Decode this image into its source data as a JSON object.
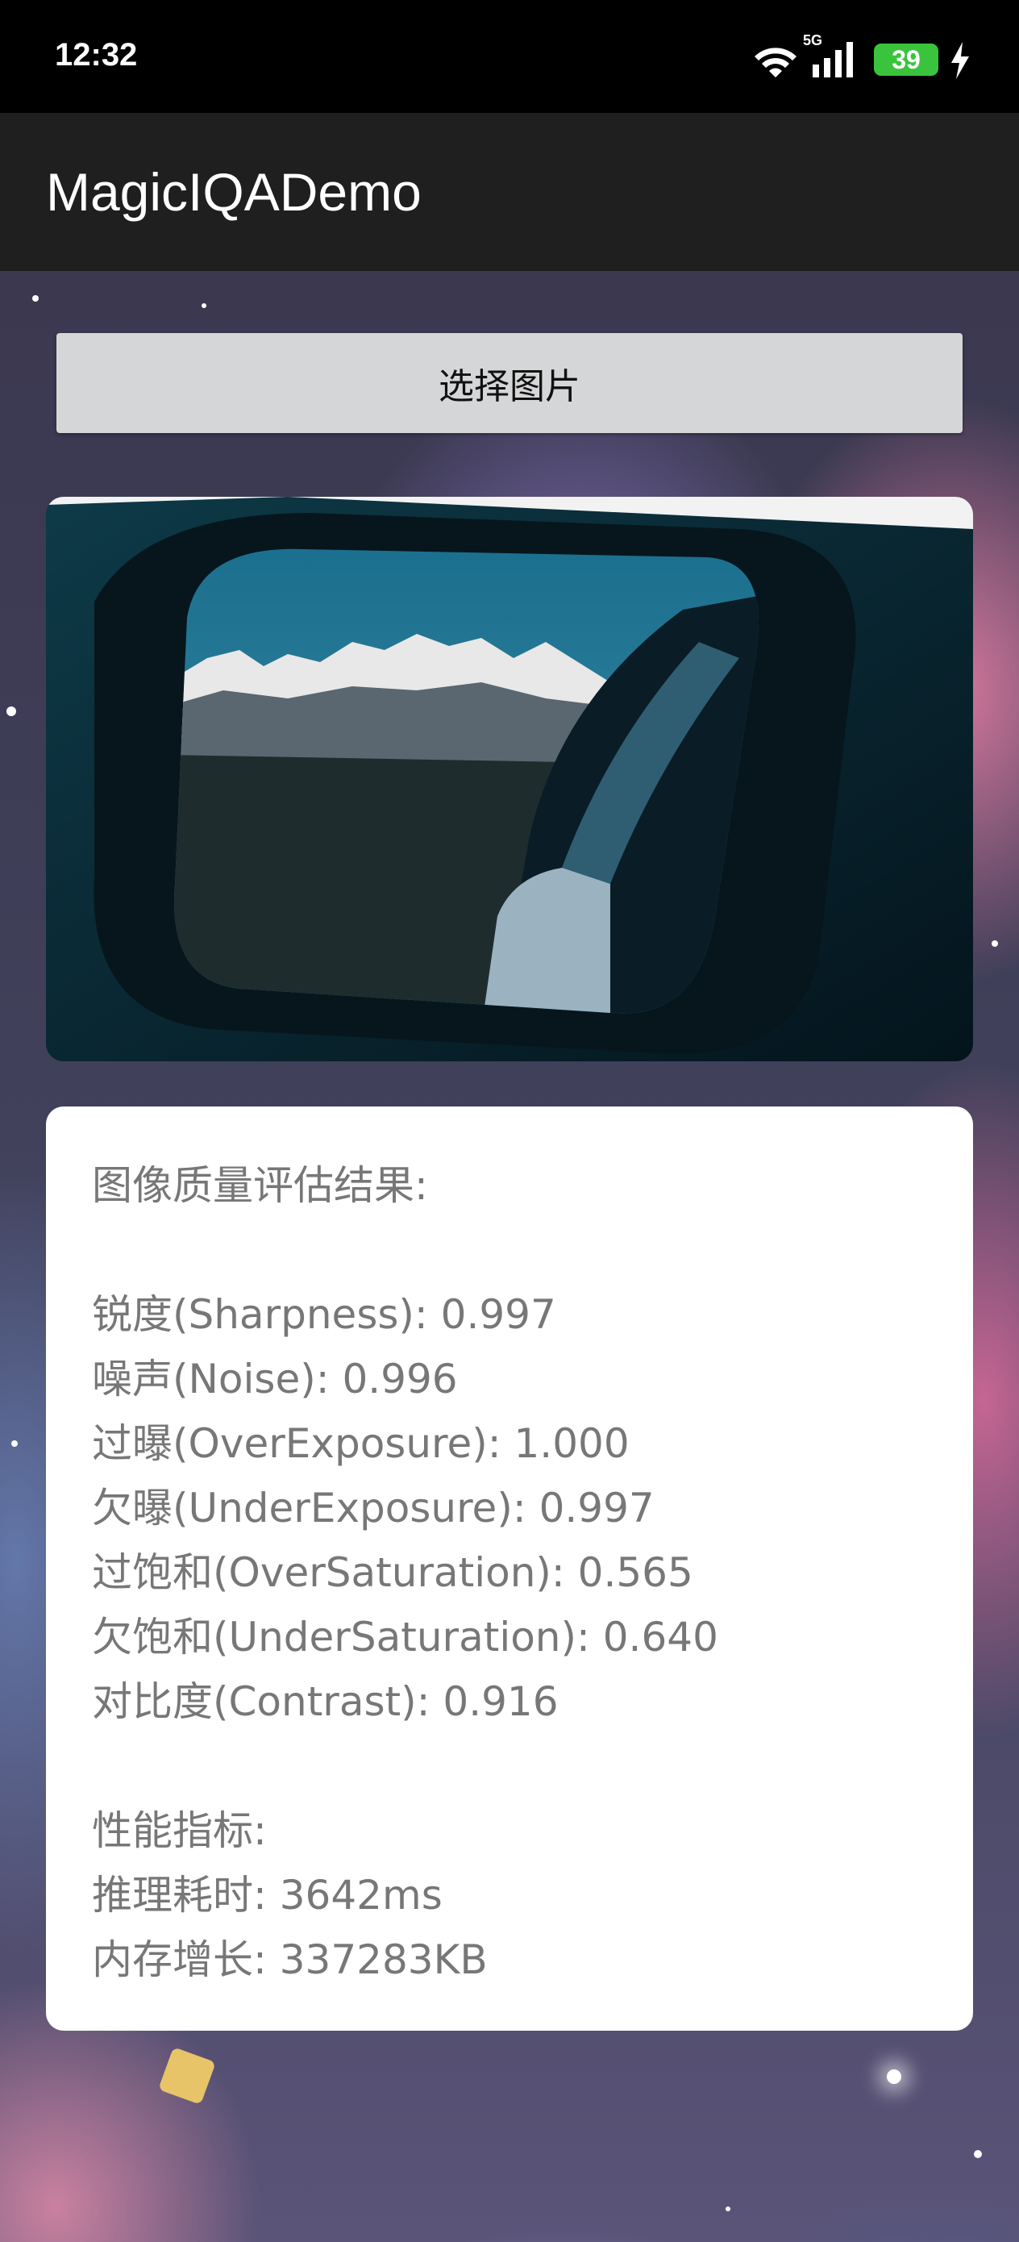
{
  "status_bar": {
    "time": "12:32",
    "network": "5G",
    "battery_level": "39",
    "charging": true,
    "icons": [
      "wifi-icon",
      "signal-icon",
      "battery-icon",
      "charging-bolt-icon"
    ]
  },
  "app_bar": {
    "title": "MagicIQADemo"
  },
  "actions": {
    "select_image_label": "选择图片"
  },
  "image_preview": {
    "description_icon": "mirror-mountain-photo"
  },
  "results": {
    "heading": "图像质量评估结果:",
    "metrics": [
      "锐度(Sharpness): 0.997",
      "噪声(Noise): 0.996",
      "过曝(OverExposure): 1.000",
      "欠曝(UnderExposure): 0.997",
      "过饱和(OverSaturation): 0.565",
      "欠饱和(UnderSaturation): 0.640",
      "对比度(Contrast): 0.916"
    ],
    "performance_heading": "性能指标:",
    "performance": [
      "推理耗时: 3642ms",
      "内存增长: 337283KB"
    ]
  },
  "colors": {
    "app_bar": "#1f1f1f",
    "status_bar": "#000000",
    "button": "#d5d6d7",
    "battery": "#3ac43d",
    "result_text": "#777777"
  }
}
